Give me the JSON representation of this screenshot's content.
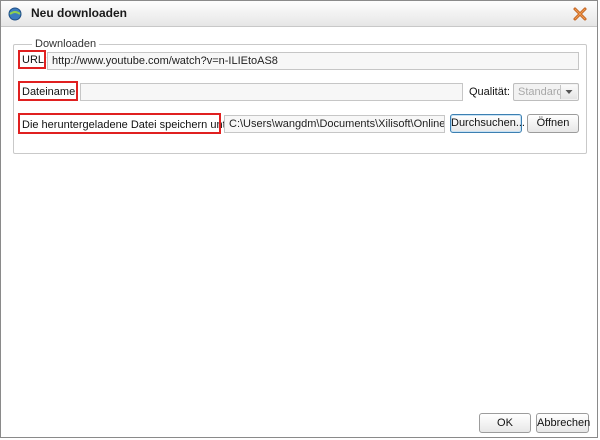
{
  "window": {
    "title": "Neu downloaden"
  },
  "group": {
    "legend": "Downloaden"
  },
  "url": {
    "label": "URL:",
    "value": "http://www.youtube.com/watch?v=n-ILIEtoAS8"
  },
  "filename": {
    "label": "Dateiname:",
    "value": ""
  },
  "quality": {
    "label": "Qualität:",
    "selected": "Standard"
  },
  "save": {
    "label": "Die heruntergeladene Datei speichern unter:",
    "path": "C:\\Users\\wangdm\\Documents\\Xilisoft\\Online Vi",
    "browse_label": "Durchsuchen...",
    "open_label": "Öffnen"
  },
  "footer": {
    "ok_label": "OK",
    "cancel_label": "Abbrechen"
  },
  "colors": {
    "highlight": "#e02020",
    "focus_border": "#3c7fb1"
  },
  "icons": {
    "app": "globe-download-icon",
    "close": "close-x-icon",
    "dropdown": "chevron-down-icon"
  }
}
